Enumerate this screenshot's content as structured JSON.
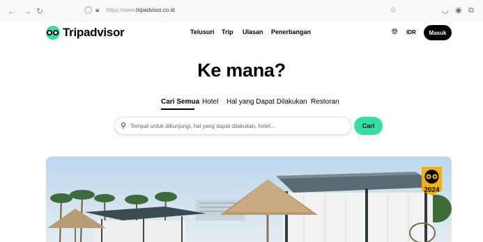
{
  "browser": {
    "url_prefix": "https://www.",
    "url_domain": "tripadvisor.co.id",
    "icons": {
      "back": "back-arrow-icon",
      "forward": "forward-arrow-icon",
      "reload": "reload-icon",
      "shield": "shield-icon",
      "lock": "lock-icon",
      "bookmark": "star-icon",
      "pocket": "pocket-icon",
      "account": "account-icon",
      "extensions": "extensions-icon"
    }
  },
  "header": {
    "logo_text": "Tripadvisor",
    "nav": [
      "Telusuri",
      "Trip",
      "Ulasan",
      "Penerbangan"
    ],
    "currency": "IDR",
    "signin_label": "Masuk"
  },
  "main": {
    "headline": "Ke mana?",
    "tabs": [
      "Cari Semua",
      "Hotel",
      "Hal yang Dapat Dilakukan",
      "Restoran"
    ],
    "active_tab": 0,
    "search_placeholder": "Tempat untuk dikunjungi, hal yang dapat dilakukan, hotel...",
    "search_button": "Cari"
  },
  "hero": {
    "badge_year": "2024"
  },
  "colors": {
    "brand_green": "#34e0a1",
    "badge_yellow": "#f2b203",
    "black": "#000000"
  }
}
